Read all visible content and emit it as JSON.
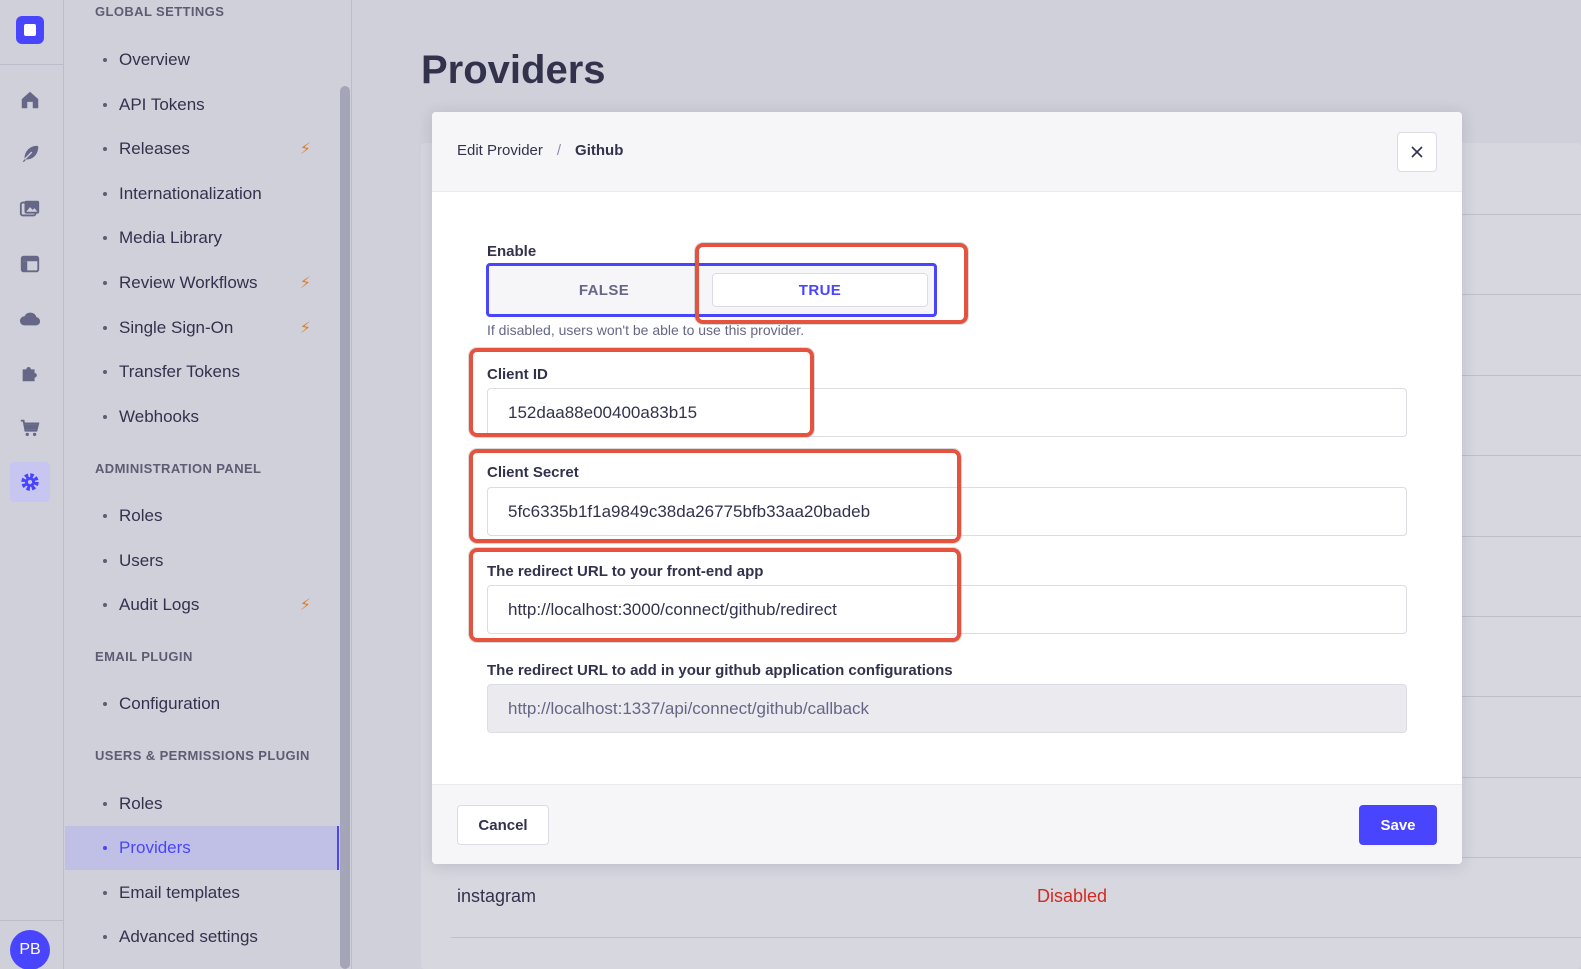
{
  "rail": {
    "icons": [
      "home-icon",
      "feather-icon",
      "images-icon",
      "layout-icon",
      "cloud-icon",
      "puzzle-icon",
      "cart-icon",
      "gear-icon"
    ],
    "avatar_initials": "PB"
  },
  "subnav": {
    "sections": [
      {
        "title": "GLOBAL SETTINGS"
      },
      {
        "title": "ADMINISTRATION PANEL"
      },
      {
        "title": "EMAIL PLUGIN"
      },
      {
        "title": "USERS & PERMISSIONS PLUGIN"
      }
    ],
    "global": [
      "Overview",
      "API Tokens",
      "Releases",
      "Internationalization",
      "Media Library",
      "Review Workflows",
      "Single Sign-On",
      "Transfer Tokens",
      "Webhooks"
    ],
    "admin": [
      "Roles",
      "Users",
      "Audit Logs"
    ],
    "email": [
      "Configuration"
    ],
    "users": [
      "Roles",
      "Providers",
      "Email templates",
      "Advanced settings"
    ]
  },
  "page": {
    "title": "Providers",
    "bg_row_name": "instagram",
    "bg_row_status": "Disabled"
  },
  "modal": {
    "breadcrumb_parent": "Edit Provider",
    "breadcrumb_separator": "/",
    "breadcrumb_current": "Github",
    "enable_label": "Enable",
    "toggle_false": "FALSE",
    "toggle_true": "TRUE",
    "enable_hint": "If disabled, users won't be able to use this provider.",
    "client_id_label": "Client ID",
    "client_id_value": "152daa88e00400a83b15",
    "client_secret_label": "Client Secret",
    "client_secret_value": "5fc6335b1f1a9849c38da26775bfb33aa20badeb",
    "redirect_front_label": "The redirect URL to your front-end app",
    "redirect_front_value": "http://localhost:3000/connect/github/redirect",
    "redirect_github_label": "The redirect URL to add in your github application configurations",
    "redirect_github_value": "http://localhost:1337/api/connect/github/callback",
    "cancel_label": "Cancel",
    "save_label": "Save"
  },
  "colors": {
    "primary": "#4945ff",
    "annotation_red": "#e5533f",
    "danger": "#d02b20",
    "pro_bolt": "#d9822f"
  }
}
